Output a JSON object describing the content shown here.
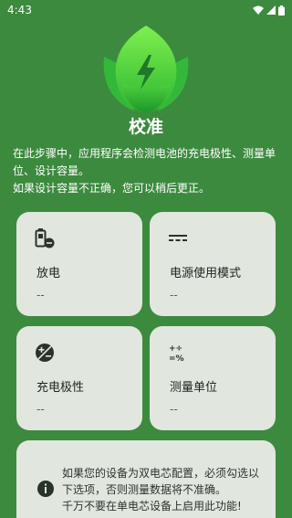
{
  "status_bar": {
    "time": "4:43"
  },
  "title": "校准",
  "description": {
    "line1": "在此步骤中，应用程序会检测电池的充电极性、测量单位、设计容量。",
    "line2": "如果设计容量不正确，您可以稍后更正。"
  },
  "cards": {
    "discharge": {
      "label": "放电",
      "value": "--",
      "icon": "battery-minus-icon"
    },
    "power_mode": {
      "label": "电源使用模式",
      "value": "--",
      "icon": "dc-power-icon"
    },
    "polarity": {
      "label": "充电极性",
      "value": "--",
      "icon": "plus-minus-circle-icon"
    },
    "unit": {
      "label": "测量单位",
      "value": "--",
      "icon": "math-symbols-icon"
    }
  },
  "notice": {
    "line1": "如果您的设备为双电芯配置，必须勾选以下选项，否则测量数据将不准确。",
    "line2": "千万不要在单电芯设备上启用此功能!",
    "icon": "info-icon"
  },
  "colors": {
    "background": "#3c8a3e",
    "card": "#e1e6df",
    "leaf_light": "#6fe04a",
    "leaf_dark": "#1f9a2c"
  }
}
